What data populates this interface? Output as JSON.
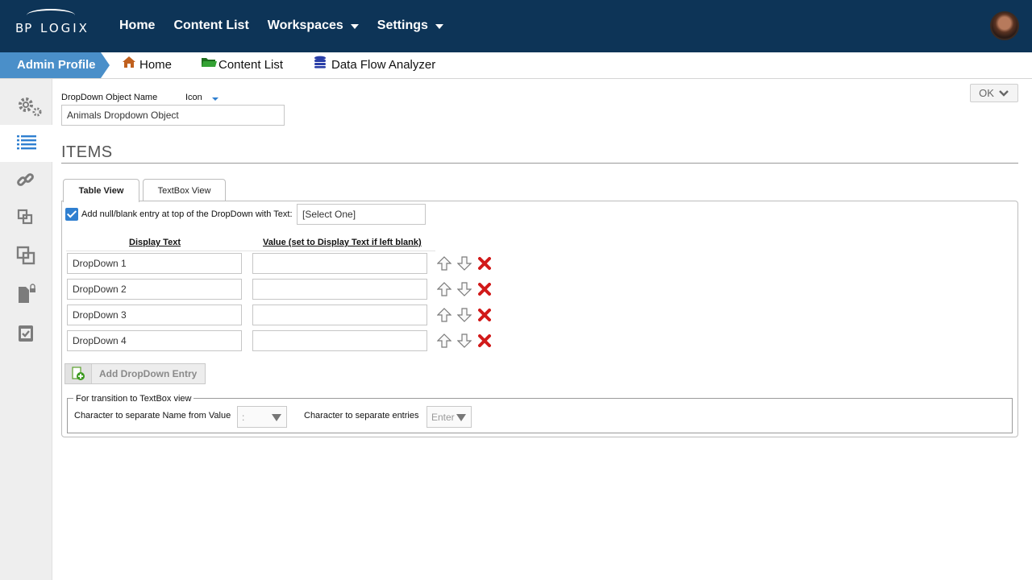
{
  "brand": {
    "logo_left": "BP",
    "logo_right": "LOGIX"
  },
  "topnav": [
    {
      "label": "Home",
      "has_menu": false
    },
    {
      "label": "Content List",
      "has_menu": false
    },
    {
      "label": "Workspaces",
      "has_menu": true
    },
    {
      "label": "Settings",
      "has_menu": true
    }
  ],
  "breadcrumb": {
    "active": "Admin Profile",
    "items": [
      {
        "label": "Home",
        "icon": "home-icon"
      },
      {
        "label": "Content List",
        "icon": "folder-icon"
      },
      {
        "label": "Data Flow Analyzer",
        "icon": "database-icon"
      }
    ]
  },
  "sidebar": {
    "items": [
      "gears-icon",
      "list-icon",
      "link-icon",
      "sub-form-icon",
      "copy-icon",
      "locked-document-icon",
      "checked-document-icon"
    ],
    "active_index": 1
  },
  "form": {
    "name_label": "DropDown Object Name",
    "icon_label": "Icon",
    "name_value": "Animals Dropdown Object",
    "ok_label": "OK"
  },
  "items_section": {
    "title": "ITEMS",
    "tabs": [
      {
        "label": "Table View",
        "active": true
      },
      {
        "label": "TextBox View",
        "active": false
      }
    ],
    "null_entry_label": "Add null/blank entry at top of the DropDown with Text:",
    "null_entry_checked": true,
    "null_entry_text": "[Select One]",
    "columns": [
      "Display Text",
      "Value (set to Display Text if left blank)"
    ],
    "rows": [
      {
        "display": "DropDown 1",
        "value": ""
      },
      {
        "display": "DropDown 2",
        "value": ""
      },
      {
        "display": "DropDown 3",
        "value": ""
      },
      {
        "display": "DropDown 4",
        "value": ""
      }
    ],
    "add_button": "Add DropDown Entry",
    "transition": {
      "legend": "For transition to TextBox view",
      "name_value_label": "Character to separate Name from Value",
      "name_value_sep": ":",
      "entries_label": "Character to separate entries",
      "entries_sep": "Enter"
    }
  },
  "colors": {
    "topbar": "#0d3457",
    "breadcrumb_active": "#4a8fc9",
    "checkbox": "#2f7fd0",
    "delete": "#d11a1a",
    "folder": "#2e8b2e",
    "home": "#c0601e",
    "database": "#2a3fa8"
  }
}
